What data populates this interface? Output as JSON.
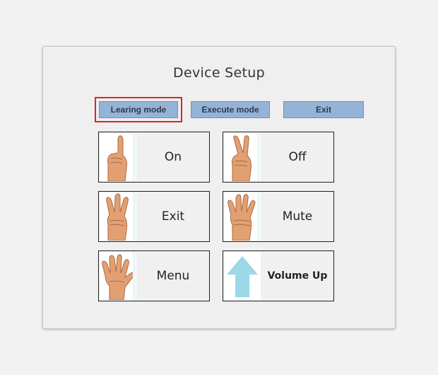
{
  "title": "Device Setup",
  "mode_buttons": [
    {
      "label": "Learing mode",
      "selected": true
    },
    {
      "label": "Execute mode",
      "selected": false
    },
    {
      "label": "Exit",
      "selected": false
    }
  ],
  "gesture_cards": [
    {
      "label": "On",
      "icon": "one-finger-hand-icon"
    },
    {
      "label": "Off",
      "icon": "two-finger-hand-icon"
    },
    {
      "label": "Exit",
      "icon": "three-finger-hand-icon"
    },
    {
      "label": "Mute",
      "icon": "four-finger-hand-icon"
    },
    {
      "label": "Menu",
      "icon": "open-hand-icon"
    },
    {
      "label": "Volume Up",
      "icon": "up-arrow-icon"
    }
  ],
  "colors": {
    "button_fill": "#95b3d7",
    "selection_outline": "#d9262e",
    "arrow": "#9bd8e8",
    "skin": "#e2a072"
  }
}
